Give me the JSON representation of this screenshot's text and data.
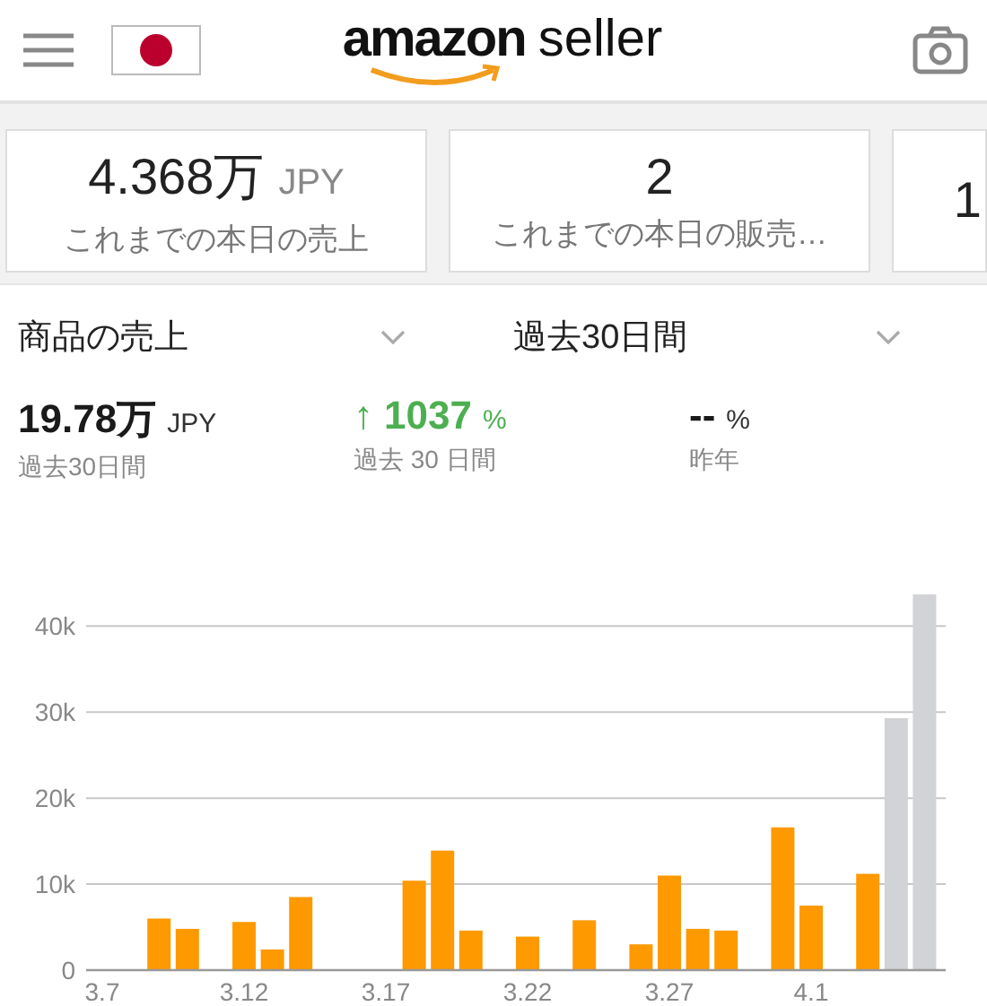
{
  "header": {
    "logo": {
      "brand": "amazon",
      "suffix": "seller"
    }
  },
  "summary_cards": [
    {
      "value": "4.368万",
      "unit": "JPY",
      "label": "これまでの本日の売上"
    },
    {
      "value": "2",
      "label": "これまでの本日の販売…"
    },
    {
      "value": "1"
    }
  ],
  "filters": [
    {
      "label": "商品の売上"
    },
    {
      "label": "過去30日間"
    }
  ],
  "metrics": [
    {
      "kind": "total",
      "value": "19.78万",
      "unit": "JPY",
      "caption": "過去30日間"
    },
    {
      "kind": "change",
      "arrow": "↑",
      "value": "1037",
      "unit": "%",
      "caption": "過去 30 日間"
    },
    {
      "kind": "plain",
      "value": "--",
      "unit": "%",
      "caption": "昨年"
    }
  ],
  "chart_data": {
    "type": "bar",
    "categories": [
      "3.7",
      null,
      null,
      null,
      null,
      "3.12",
      null,
      null,
      null,
      null,
      "3.17",
      null,
      null,
      null,
      null,
      "3.22",
      null,
      null,
      null,
      null,
      "3.27",
      null,
      null,
      null,
      null,
      "4.1",
      null,
      null,
      null,
      null
    ],
    "grid": true,
    "ylim": [
      0,
      44000
    ],
    "yticks": [
      {
        "value": 0,
        "label": "0"
      },
      {
        "value": 10000,
        "label": "10k"
      },
      {
        "value": 20000,
        "label": "20k"
      },
      {
        "value": 30000,
        "label": "30k"
      },
      {
        "value": 40000,
        "label": "40k"
      }
    ],
    "series": [
      {
        "color": "#ff9900",
        "values": [
          0,
          0,
          6000,
          4800,
          0,
          5600,
          2400,
          8500,
          0,
          0,
          0,
          10400,
          13900,
          4600,
          0,
          3900,
          0,
          5800,
          0,
          3000,
          11000,
          4800,
          4600,
          0,
          16600,
          7500,
          0,
          11200,
          0,
          0
        ]
      },
      {
        "color": "#d1d3d6",
        "values": [
          0,
          0,
          0,
          0,
          0,
          0,
          0,
          0,
          0,
          0,
          0,
          0,
          0,
          0,
          0,
          0,
          0,
          0,
          0,
          0,
          0,
          0,
          0,
          0,
          0,
          0,
          0,
          0,
          29300,
          43700
        ]
      }
    ]
  }
}
